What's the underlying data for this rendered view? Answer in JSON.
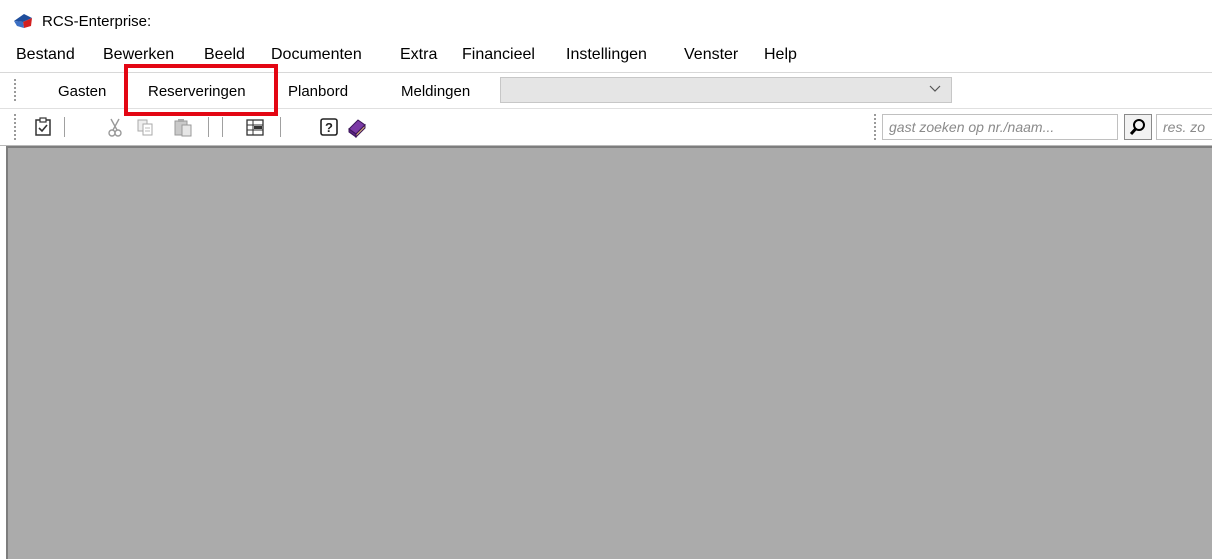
{
  "window": {
    "title": "RCS-Enterprise:"
  },
  "menu": {
    "items": [
      {
        "label": "Bestand"
      },
      {
        "label": "Bewerken"
      },
      {
        "label": "Beeld"
      },
      {
        "label": "Documenten"
      },
      {
        "label": "Extra"
      },
      {
        "label": "Financieel"
      },
      {
        "label": "Instellingen"
      },
      {
        "label": "Venster"
      },
      {
        "label": "Help"
      }
    ]
  },
  "nav": {
    "tabs": [
      {
        "label": "Gasten"
      },
      {
        "label": "Reserveringen"
      },
      {
        "label": "Planbord"
      },
      {
        "label": "Meldingen"
      }
    ],
    "combo_value": ""
  },
  "toolbar": {
    "icons": [
      "checklist-icon",
      "cut-icon",
      "copy-icon",
      "paste-icon",
      "grid-icon",
      "help-icon",
      "book-icon"
    ],
    "guest_search": {
      "placeholder": "gast zoeken op nr./naam..."
    },
    "res_search": {
      "placeholder": "res. zo"
    }
  },
  "colors": {
    "workspace": "#ababab",
    "highlight": "#e30613"
  }
}
